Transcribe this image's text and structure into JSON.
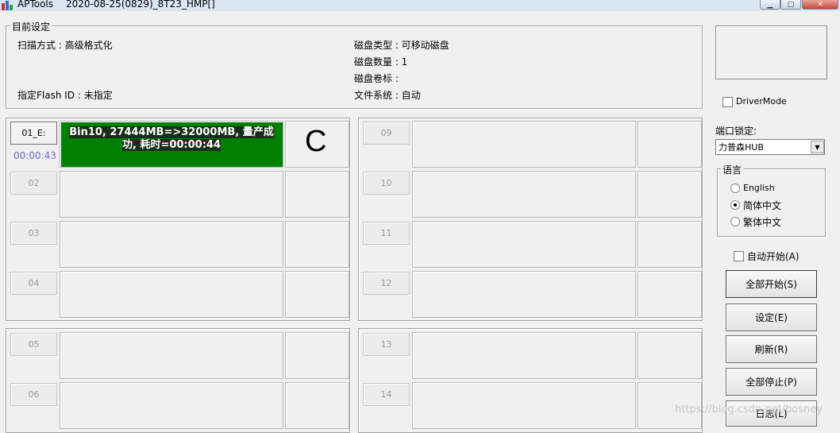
{
  "window": {
    "app_name": "APTools",
    "title": "2020-08-25(0829)_8T23_HMP[]",
    "minimize_glyph": "▁",
    "maximize_glyph": "□",
    "close_glyph": "✕"
  },
  "settings": {
    "group_title": "目前设定",
    "scan_mode": "扫描方式 : 高级格式化",
    "flash_id": "指定Flash ID : 未指定",
    "disk_type": "磁盘类型 : 可移动磁盘",
    "disk_count": "磁盘数量 : 1",
    "disk_label": "磁盘卷标 :",
    "file_system": "文件系统 : 自动"
  },
  "slots": {
    "s01": {
      "label": "01_E:",
      "time": "00:00:43",
      "message_line1": "Bin10, 27444MB=>32000MB, 量产成",
      "message_line2": "功, 耗时=00:00:44",
      "drive_letter": "C",
      "status_color": "#008000"
    },
    "s02": {
      "label": "02"
    },
    "s03": {
      "label": "03"
    },
    "s04": {
      "label": "04"
    },
    "s05": {
      "label": "05"
    },
    "s06": {
      "label": "06"
    },
    "s09": {
      "label": "09"
    },
    "s10": {
      "label": "10"
    },
    "s11": {
      "label": "11"
    },
    "s12": {
      "label": "12"
    },
    "s13": {
      "label": "13"
    },
    "s14": {
      "label": "14"
    }
  },
  "right": {
    "driver_mode": "DriverMode",
    "port_lock_label": "端口锁定:",
    "port_lock_value": "力普森HUB",
    "language_title": "语言",
    "lang_english": "English",
    "lang_simplified": "简体中文",
    "lang_traditional": "繁体中文",
    "auto_start": "自动开始(A)",
    "start_all": "全部开始(S)",
    "settings_btn": "设定(E)",
    "refresh": "刷新(R)",
    "stop_all": "全部停止(P)",
    "log": "日志(L)"
  },
  "watermark": "https://blog.csdn.net/bosney",
  "icons": {
    "app": "app-icon",
    "dropdown": "chevron-down-icon"
  }
}
